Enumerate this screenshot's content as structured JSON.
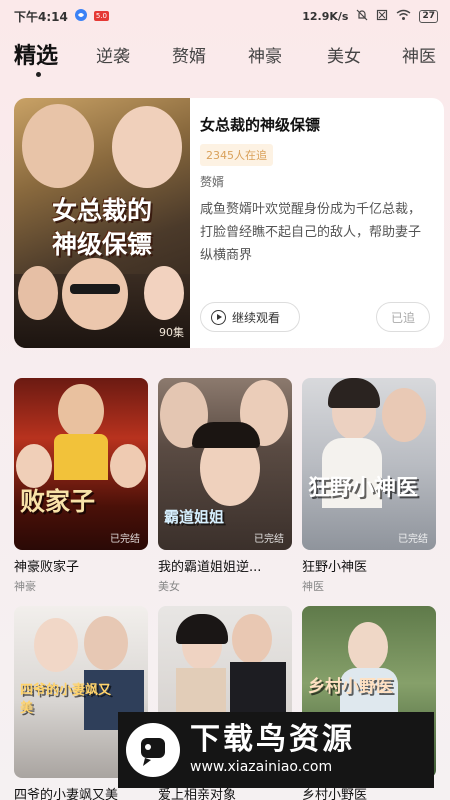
{
  "status": {
    "time": "下午4:14",
    "badge": "5.0",
    "speed": "12.9K/s",
    "battery": "27"
  },
  "tabs": [
    "精选",
    "逆袭",
    "赘婿",
    "神豪",
    "美女",
    "神医"
  ],
  "featured": {
    "title": "女总裁的神级保镖",
    "poster_title": "女总裁的\n神级保镖",
    "poster_badge": "90集",
    "followers": "2345人在追",
    "genre": "赘婿",
    "description": "咸鱼赘婿叶欢觉醒身份成为千亿总裁，打脸曾经瞧不起自己的敌人，帮助妻子纵横商界",
    "watch_label": "继续观看",
    "followed_label": "已追"
  },
  "grid": [
    {
      "title": "神豪败家子",
      "genre": "神豪",
      "poster": "败家子",
      "status": "已完结"
    },
    {
      "title": "我的霸道姐姐逆...",
      "genre": "美女",
      "poster": "霸道姐姐",
      "status": "已完结"
    },
    {
      "title": "狂野小神医",
      "genre": "神医",
      "poster": "狂野小神医",
      "status": "已完结"
    },
    {
      "title": "四爷的小妻飒又美",
      "genre": "",
      "poster": "四爷的小妻飒又美",
      "status": ""
    },
    {
      "title": "爱上相亲对象",
      "genre": "",
      "poster": "",
      "status": ""
    },
    {
      "title": "乡村小野医",
      "genre": "",
      "poster": "乡村小野医",
      "status": ""
    }
  ],
  "watermark": {
    "brand": "下载鸟资源",
    "url": "www.xiazainiao.com"
  }
}
